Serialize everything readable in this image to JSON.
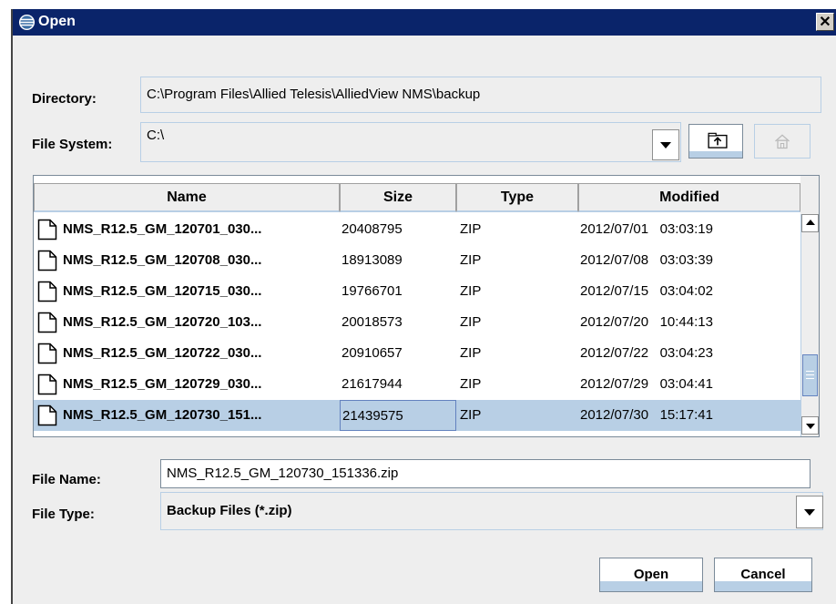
{
  "window": {
    "title": "Open",
    "close_glyph": "✕"
  },
  "directory": {
    "label": "Directory:",
    "value": "C:\\Program Files\\Allied Telesis\\AlliedView NMS\\backup"
  },
  "file_system": {
    "label": "File System:",
    "value": "C:\\"
  },
  "table": {
    "columns": [
      "Name",
      "Size",
      "Type",
      "Modified"
    ],
    "rows": [
      {
        "name": "NMS_R12.5_GM_120701_030...",
        "size": "20408795",
        "type": "ZIP",
        "modified": "2012/07/01   03:03:19"
      },
      {
        "name": "NMS_R12.5_GM_120708_030...",
        "size": "18913089",
        "type": "ZIP",
        "modified": "2012/07/08   03:03:39"
      },
      {
        "name": "NMS_R12.5_GM_120715_030...",
        "size": "19766701",
        "type": "ZIP",
        "modified": "2012/07/15   03:04:02"
      },
      {
        "name": "NMS_R12.5_GM_120720_103...",
        "size": "20018573",
        "type": "ZIP",
        "modified": "2012/07/20   10:44:13"
      },
      {
        "name": "NMS_R12.5_GM_120722_030...",
        "size": "20910657",
        "type": "ZIP",
        "modified": "2012/07/22   03:04:23"
      },
      {
        "name": "NMS_R12.5_GM_120729_030...",
        "size": "21617944",
        "type": "ZIP",
        "modified": "2012/07/29   03:04:41"
      },
      {
        "name": "NMS_R12.5_GM_120730_151...",
        "size": "21439575",
        "type": "ZIP",
        "modified": "2012/07/30   15:17:41",
        "selected": true
      }
    ]
  },
  "file_name": {
    "label": "File Name:",
    "value": "NMS_R12.5_GM_120730_151336.zip"
  },
  "file_type": {
    "label": "File Type:",
    "value": "Backup Files (*.zip)"
  },
  "buttons": {
    "open": "Open",
    "cancel": "Cancel"
  },
  "colors": {
    "title_bar": "#0a246a",
    "selection": "#b8cfe5",
    "panel": "#eeeeee"
  }
}
